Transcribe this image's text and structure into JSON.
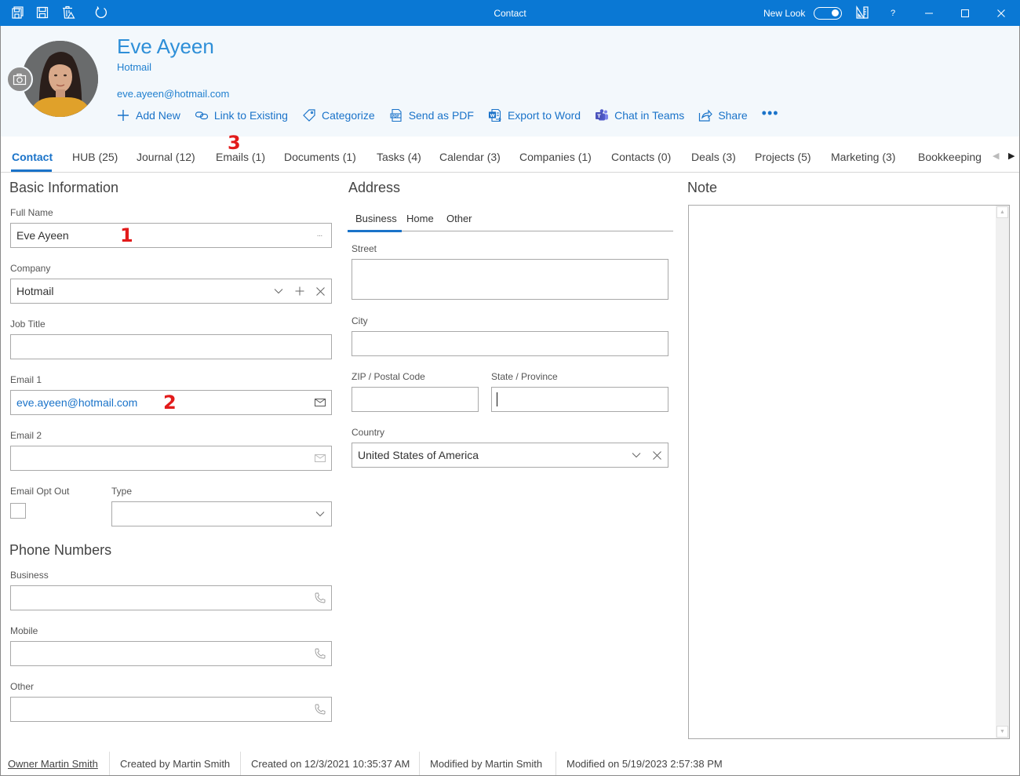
{
  "window": {
    "title": "Contact",
    "new_look_label": "New Look",
    "help_label": "?",
    "quick_icons": [
      "save-and-close-icon",
      "save-icon",
      "delete-icon",
      "refresh-icon"
    ]
  },
  "header": {
    "name": "Eve Ayeen",
    "company": "Hotmail",
    "email": "eve.ayeen@hotmail.com",
    "actions": [
      {
        "label": "Add New",
        "icon": "plus-icon"
      },
      {
        "label": "Link to Existing",
        "icon": "link-icon"
      },
      {
        "label": "Categorize",
        "icon": "tag-icon"
      },
      {
        "label": "Send as PDF",
        "icon": "pdf-icon"
      },
      {
        "label": "Export to Word",
        "icon": "word-icon"
      },
      {
        "label": "Chat in Teams",
        "icon": "teams-icon"
      },
      {
        "label": "Share",
        "icon": "share-icon"
      },
      {
        "label": "•••",
        "icon": "more-icon"
      }
    ]
  },
  "tabs": [
    {
      "label": "Contact",
      "active": true
    },
    {
      "label": "HUB (25)"
    },
    {
      "label": "Journal (12)"
    },
    {
      "label": "Emails (1)"
    },
    {
      "label": "Documents (1)"
    },
    {
      "label": "Tasks (4)"
    },
    {
      "label": "Calendar (3)"
    },
    {
      "label": "Companies (1)"
    },
    {
      "label": "Contacts (0)"
    },
    {
      "label": "Deals (3)"
    },
    {
      "label": "Projects (5)"
    },
    {
      "label": "Marketing (3)"
    },
    {
      "label": "Bookkeeping"
    }
  ],
  "annotations": [
    "1",
    "2",
    "3"
  ],
  "basic": {
    "title": "Basic Information",
    "full_name_label": "Full Name",
    "full_name": "Eve Ayeen",
    "company_label": "Company",
    "company": "Hotmail",
    "job_title_label": "Job Title",
    "job_title": "",
    "email1_label": "Email 1",
    "email1": "eve.ayeen@hotmail.com",
    "email2_label": "Email 2",
    "email2": "",
    "opt_out_label": "Email Opt Out",
    "opt_out": false,
    "type_label": "Type",
    "type": ""
  },
  "phones": {
    "title": "Phone Numbers",
    "business_label": "Business",
    "business": "",
    "mobile_label": "Mobile",
    "mobile": "",
    "other_label": "Other",
    "other": ""
  },
  "address": {
    "title": "Address",
    "tabs": [
      "Business",
      "Home",
      "Other"
    ],
    "active_tab": "Business",
    "street_label": "Street",
    "street": "",
    "city_label": "City",
    "city": "",
    "zip_label": "ZIP / Postal Code",
    "zip": "",
    "state_label": "State / Province",
    "state": "",
    "country_label": "Country",
    "country": "United States of America"
  },
  "note": {
    "title": "Note",
    "value": ""
  },
  "footer": {
    "owner": "Owner Martin Smith",
    "created_by": "Created by Martin Smith",
    "created_on": "Created on 12/3/2021 10:35:37 AM",
    "modified_by": "Modified by Martin Smith",
    "modified_on": "Modified on 5/19/2023 2:57:38 PM"
  },
  "colors": {
    "titlebar": "#0a78d4",
    "accent": "#1a73c9",
    "annotation": "#e21b1b"
  }
}
